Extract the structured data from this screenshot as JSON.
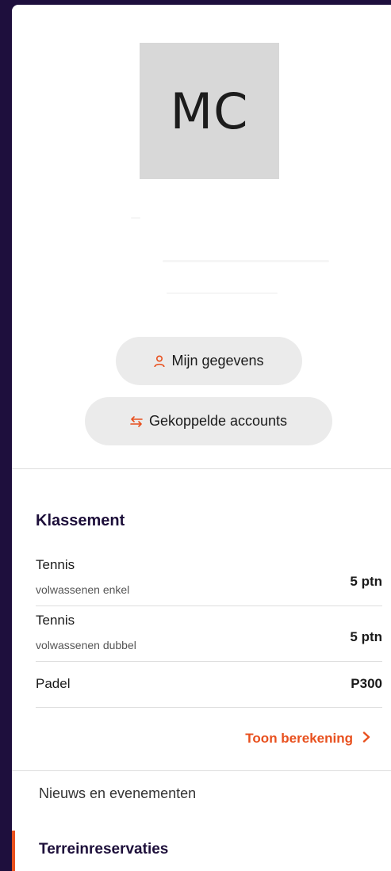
{
  "profile": {
    "initials": "MC"
  },
  "actions": {
    "my_details_label": "Mijn gegevens",
    "linked_accounts_label": "Gekoppelde accounts"
  },
  "ranking": {
    "title": "Klassement",
    "rows": [
      {
        "sport": "Tennis",
        "category": "volwassenen enkel",
        "points": "5 ptn"
      },
      {
        "sport": "Tennis",
        "category": "volwassenen dubbel",
        "points": "5 ptn"
      },
      {
        "sport": "Padel",
        "category": "",
        "points": "P300"
      }
    ],
    "show_calculation_label": "Toon berekening"
  },
  "nav": {
    "items": [
      {
        "label": "Nieuws en evenementen",
        "active": false
      },
      {
        "label": "Terreinreservaties",
        "active": true
      }
    ]
  },
  "colors": {
    "accent": "#e8501e",
    "background": "#1e0f3d"
  }
}
